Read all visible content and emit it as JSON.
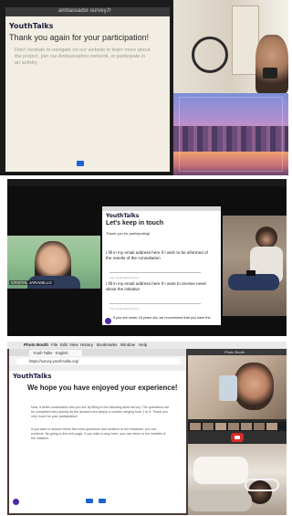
{
  "panel1": {
    "url": "ambassador-survey.fr",
    "heading": "Thank you again for your participation!",
    "body": "Don't hesitate to navigate on our website to learn more about the project, join our Ambassadors network, or participate in an activity.",
    "logo": "YouthTalks"
  },
  "panel2": {
    "participant_name": "CRISTAL JARAMILLO",
    "logo": "YouthTalks",
    "heading": "Let's keep in touch",
    "intro": "Thank you for participating!",
    "lines": [
      "I fill in my email address here if I wish to be informed of the results of the consultation",
      "I fill in my email address here if I want to receive news about the initiative",
      "If you are under 18 years old, we recommend that you have the"
    ],
    "input_placeholder": "Your email address here"
  },
  "panel3": {
    "app_title": "Photo Booth",
    "menu": [
      "Photo Booth",
      "File",
      "Edit",
      "View",
      "History",
      "Bookmarks",
      "Window",
      "Help"
    ],
    "tab_label": "Youth Talks - English",
    "url": "https://survey.youth-talks.org/",
    "logo": "YouthTalks",
    "heading": "We hope you have enjoyed your experience!",
    "para1": "Now, a better understand who you are by filling in the following short survey. The questions can be completed very quickly as the answers are simply a number ranging from 1 to 5. Thank you very much for your participation!",
    "para2": "If you want to answer these few extra questions and continue to the headsets, you can continue. By going to the next page. If you wish to stop here, you can return to the website of the initiative.",
    "booth_label": "Photo Booth"
  },
  "colors": {
    "blue_button": "#1f63d6",
    "purple_badge": "#4b2aa8",
    "red_record": "#d62b2b"
  }
}
